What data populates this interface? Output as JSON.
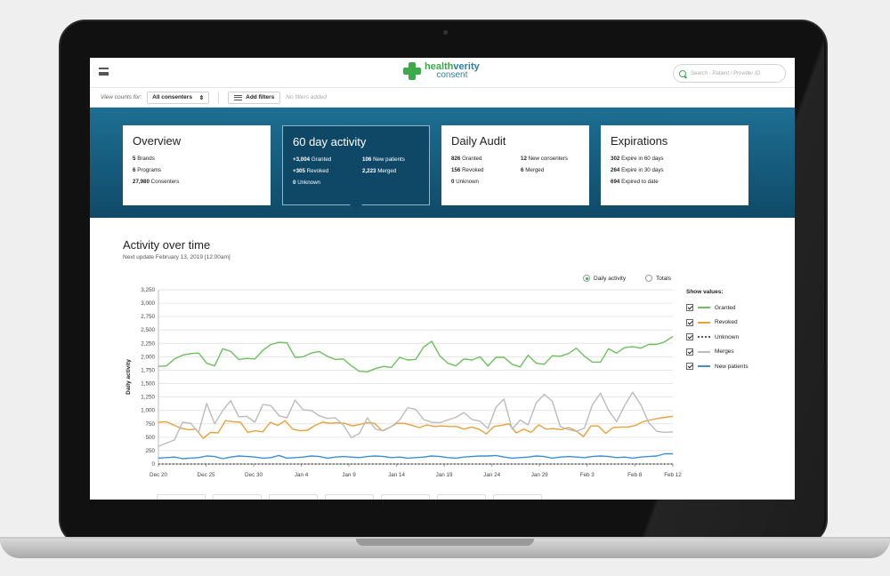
{
  "header": {
    "logo_part1": "health",
    "logo_part2": "verity",
    "logo_sub": "consent",
    "search_placeholder": "Search - Patient / Provider ID"
  },
  "filters": {
    "view_counts_label": "View counts for:",
    "consenters_select": "All consenters",
    "add_filters_label": "Add filters",
    "no_filters_text": "No filters added"
  },
  "cards": {
    "overview": {
      "title": "Overview",
      "rows": [
        {
          "num": "5",
          "label": "Brands"
        },
        {
          "num": "6",
          "label": "Programs"
        },
        {
          "num": "27,980",
          "label": "Consenters"
        }
      ]
    },
    "activity": {
      "title": "60 day activity",
      "left": [
        {
          "num": "+3,004",
          "label": "Granted"
        },
        {
          "num": "+305",
          "label": "Revoked"
        },
        {
          "num": "0",
          "label": "Unknown"
        }
      ],
      "right": [
        {
          "num": "106",
          "label": "New patients"
        },
        {
          "num": "2,223",
          "label": "Merged"
        }
      ]
    },
    "audit": {
      "title": "Daily Audit",
      "left": [
        {
          "num": "826",
          "label": "Granted"
        },
        {
          "num": "156",
          "label": "Revoked"
        },
        {
          "num": "0",
          "label": "Unknown"
        }
      ],
      "right": [
        {
          "num": "12",
          "label": "New consenters"
        },
        {
          "num": "6",
          "label": "Merged"
        }
      ]
    },
    "expirations": {
      "title": "Expirations",
      "rows": [
        {
          "num": "302",
          "label": "Expire in 60 days"
        },
        {
          "num": "264",
          "label": "Expire in 30 days"
        },
        {
          "num": "694",
          "label": "Expired to date"
        }
      ]
    }
  },
  "activity": {
    "title": "Activity over time",
    "subtitle": "Next update February 13, 2019 [12:00am]",
    "toggle_daily": "Daily activity",
    "toggle_totals": "Totals",
    "legend_title": "Show values:"
  },
  "chart_data": {
    "type": "line",
    "ylabel": "Daily activity",
    "ylim": [
      0,
      3250
    ],
    "yticks": [
      0,
      250,
      500,
      750,
      1000,
      1250,
      1500,
      1750,
      2000,
      2250,
      2500,
      2750,
      3000,
      3250
    ],
    "ytick_labels": [
      "0",
      "250",
      "500",
      "750",
      "1,000",
      "1,250",
      "1,500",
      "1,750",
      "2,000",
      "2,250",
      "2,500",
      "2,750",
      "3,000",
      "3,250"
    ],
    "xtick_labels": [
      "Dec 20",
      "Dec 25",
      "Dec 30",
      "Jan 4",
      "Jan 9",
      "Jan 14",
      "Jan 19",
      "Jan 24",
      "Jan 29",
      "Feb 3",
      "Feb 8",
      "Feb 12"
    ],
    "xtick_index": [
      0,
      5,
      10,
      15,
      20,
      25,
      30,
      35,
      40,
      45,
      50,
      54
    ],
    "series": [
      {
        "name": "Granted",
        "color": "#6cc05c",
        "style": "solid",
        "values": [
          1820,
          1830,
          1960,
          2030,
          2060,
          2070,
          1880,
          1830,
          2150,
          2100,
          1950,
          1970,
          1960,
          2120,
          2230,
          2270,
          2260,
          1990,
          2000,
          2070,
          2100,
          2010,
          1950,
          1960,
          1830,
          1730,
          1720,
          1780,
          1820,
          1800,
          1990,
          1940,
          1950,
          2180,
          2290,
          2020,
          1880,
          1830,
          1960,
          1940,
          2000,
          1830,
          1990,
          1990,
          1860,
          1810,
          2030,
          1880,
          1860,
          2020,
          2010,
          2060,
          2160,
          2010,
          1900,
          1900,
          2150,
          2070,
          2170,
          2190,
          2160,
          2230,
          2230,
          2280,
          2380
        ]
      },
      {
        "name": "Revoked",
        "color": "#e8a23c",
        "style": "solid",
        "values": [
          780,
          790,
          730,
          670,
          640,
          650,
          480,
          590,
          580,
          810,
          790,
          780,
          590,
          620,
          600,
          780,
          720,
          810,
          650,
          620,
          630,
          720,
          780,
          760,
          770,
          760,
          710,
          740,
          770,
          760,
          620,
          680,
          760,
          760,
          720,
          680,
          730,
          700,
          710,
          700,
          700,
          650,
          690,
          650,
          560,
          700,
          720,
          750,
          580,
          650,
          590,
          730,
          650,
          660,
          640,
          680,
          620,
          510,
          710,
          710,
          570,
          680,
          690,
          690,
          720,
          790,
          820,
          850,
          870,
          890
        ]
      },
      {
        "name": "Unknown",
        "color": "#555555",
        "style": "dotted",
        "values": [
          0,
          0,
          0,
          0,
          0,
          0,
          0,
          0,
          0,
          0,
          0,
          0,
          0,
          0,
          0,
          0,
          0,
          0,
          0,
          0,
          0,
          0,
          0,
          0,
          0,
          0,
          0,
          0,
          0,
          0,
          0,
          0,
          0,
          0,
          0,
          0,
          0,
          0,
          0,
          0,
          0,
          0,
          0,
          0,
          0,
          0,
          0,
          0,
          0,
          0,
          0,
          0,
          0,
          0,
          0,
          0,
          0,
          0,
          0,
          0,
          0,
          0,
          0,
          0,
          0
        ]
      },
      {
        "name": "Merges",
        "color": "#bbbbbb",
        "style": "solid",
        "values": [
          330,
          390,
          450,
          780,
          760,
          590,
          1130,
          750,
          1000,
          1180,
          880,
          890,
          780,
          1110,
          1090,
          900,
          860,
          1190,
          1010,
          1000,
          900,
          850,
          860,
          730,
          490,
          570,
          860,
          650,
          620,
          700,
          820,
          1050,
          1020,
          830,
          780,
          770,
          820,
          870,
          960,
          830,
          800,
          660,
          1060,
          1210,
          650,
          820,
          730,
          1140,
          1300,
          1170,
          700,
          640,
          610,
          670,
          1110,
          1320,
          1000,
          790,
          1090,
          1340,
          1110,
          770,
          610,
          590,
          600
        ]
      },
      {
        "name": "New patients",
        "color": "#3b8fd6",
        "style": "solid",
        "values": [
          110,
          120,
          130,
          100,
          110,
          120,
          150,
          140,
          100,
          130,
          150,
          140,
          130,
          110,
          120,
          160,
          110,
          120,
          130,
          150,
          140,
          110,
          130,
          140,
          130,
          120,
          140,
          150,
          140,
          120,
          130,
          110,
          120,
          130,
          150,
          140,
          120,
          110,
          130,
          140,
          150,
          150,
          160,
          130,
          110,
          120,
          130,
          150,
          140,
          110,
          130,
          140,
          130,
          120,
          140,
          150,
          140,
          120,
          130,
          110,
          130,
          140,
          150,
          190,
          190
        ]
      }
    ]
  }
}
